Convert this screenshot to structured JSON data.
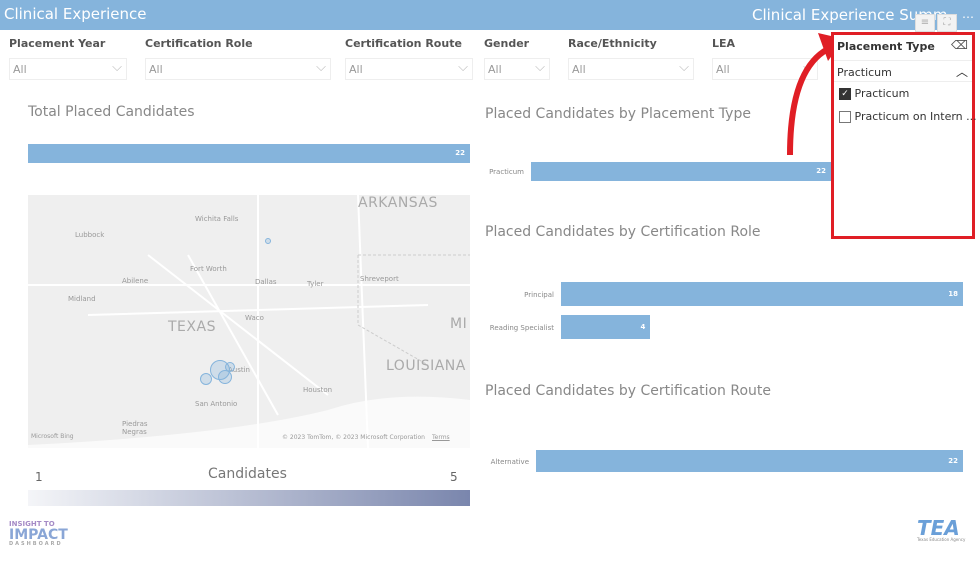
{
  "header": {
    "title": "Clinical Experience",
    "right_title": "Clinical Experience Summ"
  },
  "filters": [
    {
      "label": "Placement Year",
      "value": "All"
    },
    {
      "label": "Certification Role",
      "value": "All"
    },
    {
      "label": "Certification Route",
      "value": "All"
    },
    {
      "label": "Gender",
      "value": "All"
    },
    {
      "label": "Race/Ethnicity",
      "value": "All"
    },
    {
      "label": "LEA",
      "value": "All"
    }
  ],
  "total": {
    "title": "Total Placed Candidates",
    "value": "22"
  },
  "map": {
    "labels": [
      "ARKANSAS",
      "Wichita Falls",
      "Lubbock",
      "Fort Worth",
      "Dallas",
      "Shreveport",
      "Abilene",
      "Tyler",
      "Midland",
      "Waco",
      "TEXAS",
      "MI",
      "LOUISIANA",
      "Austin",
      "Houston",
      "San Antonio",
      "Piedras Negras"
    ],
    "copyright": "© 2023 TomTom, © 2023 Microsoft Corporation",
    "terms": "Terms",
    "bing": "Microsoft Bing"
  },
  "legend": {
    "title": "Candidates",
    "min": "1",
    "max": "5"
  },
  "chart_data": [
    {
      "type": "bar",
      "title": "Placed Candidates by Placement Type",
      "categories": [
        "Practicum"
      ],
      "values": [
        22
      ]
    },
    {
      "type": "bar",
      "title": "Placed Candidates by Certification Role",
      "categories": [
        "Principal",
        "Reading Specialist"
      ],
      "values": [
        18,
        4
      ]
    },
    {
      "type": "bar",
      "title": "Placed Candidates by Certification Route",
      "categories": [
        "Alternative"
      ],
      "values": [
        22
      ]
    }
  ],
  "slicer": {
    "title": "Placement Type",
    "selected": "Practicum",
    "options": [
      {
        "label": "Practicum",
        "checked": true
      },
      {
        "label": "Practicum on Intern ...",
        "checked": false
      }
    ]
  },
  "logos": {
    "left": "INSIGHT TO IMPACT DASHBOARD",
    "right": "TEA Texas Education Agency"
  },
  "colors": {
    "bar": "#85b4dc",
    "highlight": "#e01e25"
  }
}
